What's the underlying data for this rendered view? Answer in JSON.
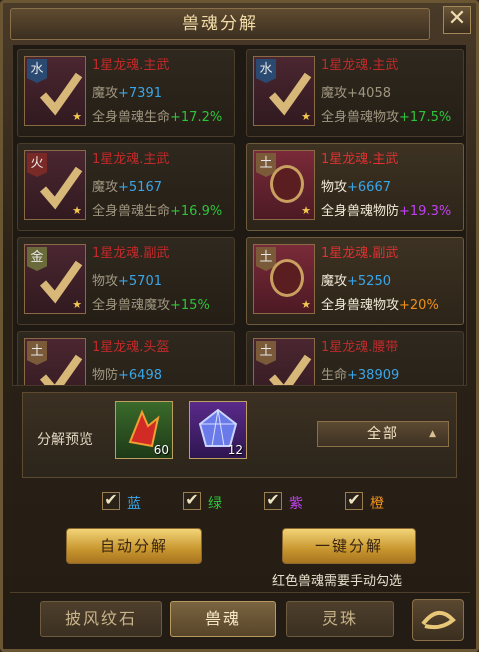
{
  "window": {
    "title": "兽魂分解",
    "close_icon": "close-x-icon"
  },
  "cards": [
    {
      "element": "水",
      "name": "1星龙魂.主武",
      "stat_label": "魔攻",
      "stat_value": "+7391",
      "bonus_label": "全身兽魂生命",
      "bonus_value": "+17.2%",
      "checked": true,
      "bright": false
    },
    {
      "element": "水",
      "name": "1星龙魂.主武",
      "stat_label": "魔攻",
      "stat_value": "+4058",
      "bonus_label": "全身兽魂物攻",
      "bonus_value": "+17.5%",
      "checked": true,
      "bright": false
    },
    {
      "element": "火",
      "name": "1星龙魂.主武",
      "stat_label": "魔攻",
      "stat_value": "+5167",
      "bonus_label": "全身兽魂生命",
      "bonus_value": "+16.9%",
      "checked": true,
      "bright": false
    },
    {
      "element": "土",
      "name": "1星龙魂.主武",
      "stat_label": "物攻",
      "stat_value": "+6667",
      "bonus_label": "全身兽魂物防",
      "bonus_value": "+19.3%",
      "checked": false,
      "bright": true
    },
    {
      "element": "金",
      "name": "1星龙魂.副武",
      "stat_label": "物攻",
      "stat_value": "+5701",
      "bonus_label": "全身兽魂魔攻",
      "bonus_value": "+15%",
      "checked": true,
      "bright": false
    },
    {
      "element": "土",
      "name": "1星龙魂.副武",
      "stat_label": "魔攻",
      "stat_value": "+5250",
      "bonus_label": "全身兽魂物攻",
      "bonus_value": "+20%",
      "checked": false,
      "bright": true
    },
    {
      "element": "土",
      "name": "1星龙魂.头盔",
      "stat_label": "物防",
      "stat_value": "+6498",
      "checked": true,
      "bright": false
    },
    {
      "element": "土",
      "name": "1星龙魂.腰带",
      "stat_label": "生命",
      "stat_value": "+38909",
      "checked": true,
      "bright": false
    }
  ],
  "preview": {
    "label": "分解预览",
    "items": [
      {
        "name": "red-crystal-icon",
        "qty": "60"
      },
      {
        "name": "blue-gem-icon",
        "qty": "12"
      }
    ],
    "select_value": "全部"
  },
  "filters": [
    {
      "label": "蓝",
      "color": "#3aa6e8",
      "checked": true
    },
    {
      "label": "绿",
      "color": "#2ec43a",
      "checked": true
    },
    {
      "label": "紫",
      "color": "#c040f0",
      "checked": true
    },
    {
      "label": "橙",
      "color": "#f0901a",
      "checked": true
    }
  ],
  "buttons": {
    "auto": "自动分解",
    "one_key": "一键分解"
  },
  "note": "红色兽魂需要手动勾选",
  "tabs": [
    {
      "label": "披风纹石",
      "active": false
    },
    {
      "label": "兽魂",
      "active": true
    },
    {
      "label": "灵珠",
      "active": false
    }
  ]
}
